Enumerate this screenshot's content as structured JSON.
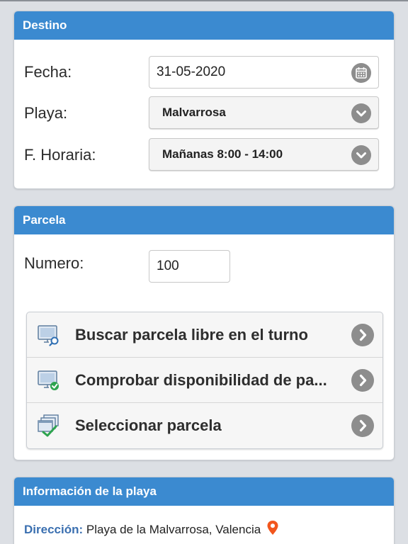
{
  "destino": {
    "title": "Destino",
    "fecha_label": "Fecha:",
    "fecha_value": "31-05-2020",
    "playa_label": "Playa:",
    "playa_value": "Malvarrosa",
    "franja_label": "F. Horaria:",
    "franja_value": "Mañanas 8:00 - 14:00"
  },
  "parcela": {
    "title": "Parcela",
    "numero_label": "Numero:",
    "numero_value": "100",
    "actions": [
      {
        "label": "Buscar parcela libre en el turno",
        "icon": "monitor-search-icon"
      },
      {
        "label": "Comprobar disponibilidad de pa...",
        "icon": "monitor-check-icon"
      },
      {
        "label": "Seleccionar parcela",
        "icon": "multi-window-check-icon"
      }
    ]
  },
  "info_playa": {
    "title": "Información de la playa",
    "direccion_label": "Dirección:",
    "direccion_value": "Playa de la Malvarrosa, Valencia"
  },
  "colors": {
    "header_blue": "#3b8ad0",
    "background": "#dcdfe4",
    "pin_orange": "#f2561d"
  }
}
